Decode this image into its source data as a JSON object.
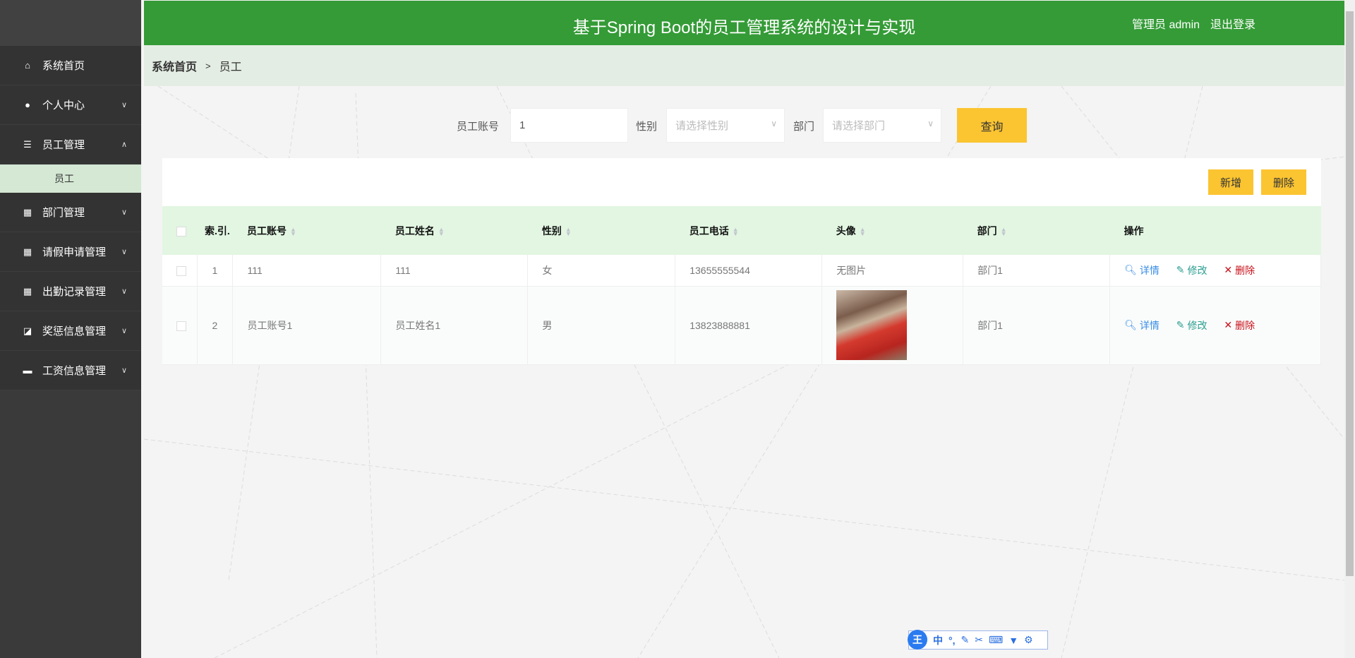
{
  "header": {
    "title": "基于Spring Boot的员工管理系统的设计与实现",
    "user": "管理员 admin",
    "logout": "退出登录"
  },
  "sidebar": {
    "items": [
      {
        "label": "系统首页",
        "icon": "home-icon"
      },
      {
        "label": "个人中心",
        "icon": "user-icon"
      },
      {
        "label": "员工管理",
        "icon": "list-icon"
      },
      {
        "label": "部门管理",
        "icon": "grid-icon"
      },
      {
        "label": "请假申请管理",
        "icon": "table-icon"
      },
      {
        "label": "出勤记录管理",
        "icon": "grid-icon"
      },
      {
        "label": "奖惩信息管理",
        "icon": "chart-icon"
      },
      {
        "label": "工资信息管理",
        "icon": "monitor-icon"
      }
    ],
    "submenu": "员工"
  },
  "breadcrumb": {
    "home": "系统首页",
    "sep": ">",
    "current": "员工"
  },
  "search": {
    "account_label": "员工账号",
    "account_value": "1",
    "gender_label": "性别",
    "gender_placeholder": "请选择性别",
    "dept_label": "部门",
    "dept_placeholder": "请选择部门",
    "query": "查询"
  },
  "toolbar": {
    "add": "新增",
    "delete": "删除"
  },
  "table": {
    "headers": [
      "索.引.",
      "员工账号",
      "员工姓名",
      "性别",
      "员工电话",
      "头像",
      "部门",
      "操作"
    ],
    "rows": [
      {
        "index": "1",
        "account": "111",
        "name": "111",
        "gender": "女",
        "phone": "13655555544",
        "avatar": "无图片",
        "dept": "部门1"
      },
      {
        "index": "2",
        "account": "员工账号1",
        "name": "员工姓名1",
        "gender": "男",
        "phone": "13823888881",
        "avatar": "",
        "dept": "部门1"
      }
    ],
    "actions": {
      "detail": "详情",
      "edit": "修改",
      "delete": "删除"
    }
  },
  "ime": {
    "logo": "王",
    "mode": "中"
  },
  "colors": {
    "header": "#349b36",
    "accent": "#fbc431",
    "table_header": "#e2f6e2"
  }
}
